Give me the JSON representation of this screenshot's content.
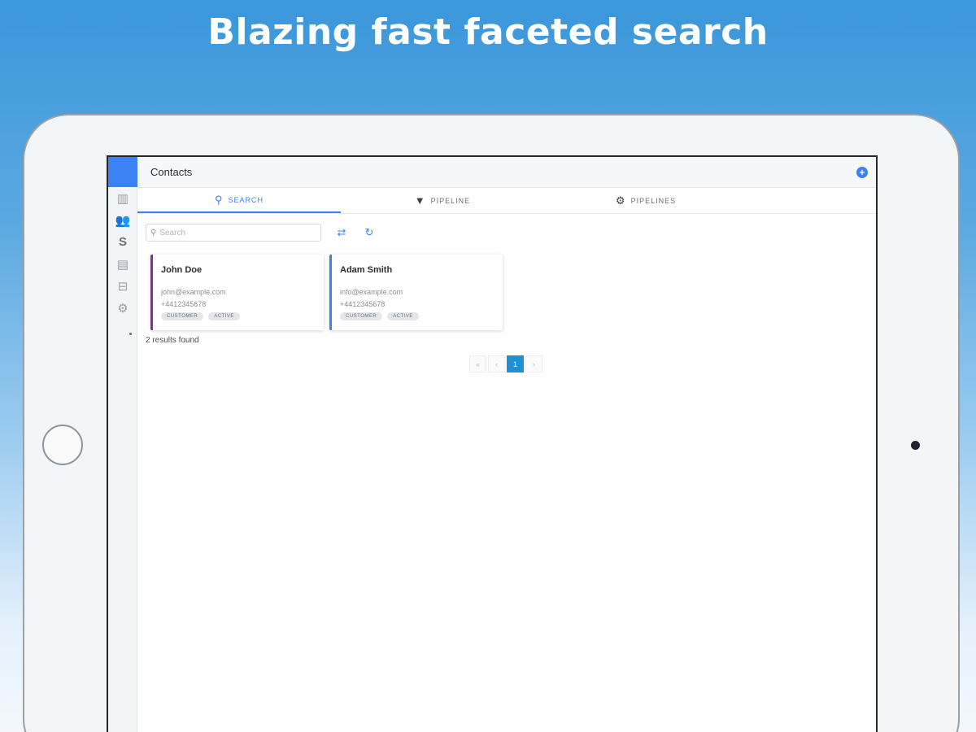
{
  "headline": "Blazing fast faceted search",
  "app": {
    "title": "Contacts",
    "add_button_icon": "plus-circle-icon",
    "accent_color": "#3d82f5"
  },
  "sidebar": {
    "items": [
      {
        "icon": "building-icon",
        "active": false
      },
      {
        "icon": "contacts-icon",
        "active": true
      },
      {
        "icon": "dollar-icon",
        "active": false
      },
      {
        "icon": "calendar-icon",
        "active": false
      },
      {
        "icon": "inbox-icon",
        "active": false
      },
      {
        "icon": "gear-icon",
        "active": false
      }
    ]
  },
  "tabs": [
    {
      "label": "SEARCH",
      "icon": "search-icon",
      "active": true
    },
    {
      "label": "PIPELINE",
      "icon": "filter-icon",
      "active": false
    },
    {
      "label": "PIPELINES",
      "icon": "gear-icon",
      "active": false
    }
  ],
  "search": {
    "placeholder": "Search",
    "value": ""
  },
  "toolbar": {
    "filter_icon": "sliders-icon",
    "refresh_icon": "refresh-icon"
  },
  "contacts": [
    {
      "name": "John Doe",
      "email": "john@example.com",
      "phone": "+4412345678",
      "tags": [
        "CUSTOMER",
        "ACTIVE"
      ],
      "accent": "#8e24aa"
    },
    {
      "name": "Adam Smith",
      "email": "info@example.com",
      "phone": "+4412345678",
      "tags": [
        "CUSTOMER",
        "ACTIVE"
      ],
      "accent": "#3d82f5"
    }
  ],
  "results_text": "2 results found",
  "pagination": {
    "first": "«",
    "prev": "‹",
    "current": "1",
    "next": "›"
  }
}
